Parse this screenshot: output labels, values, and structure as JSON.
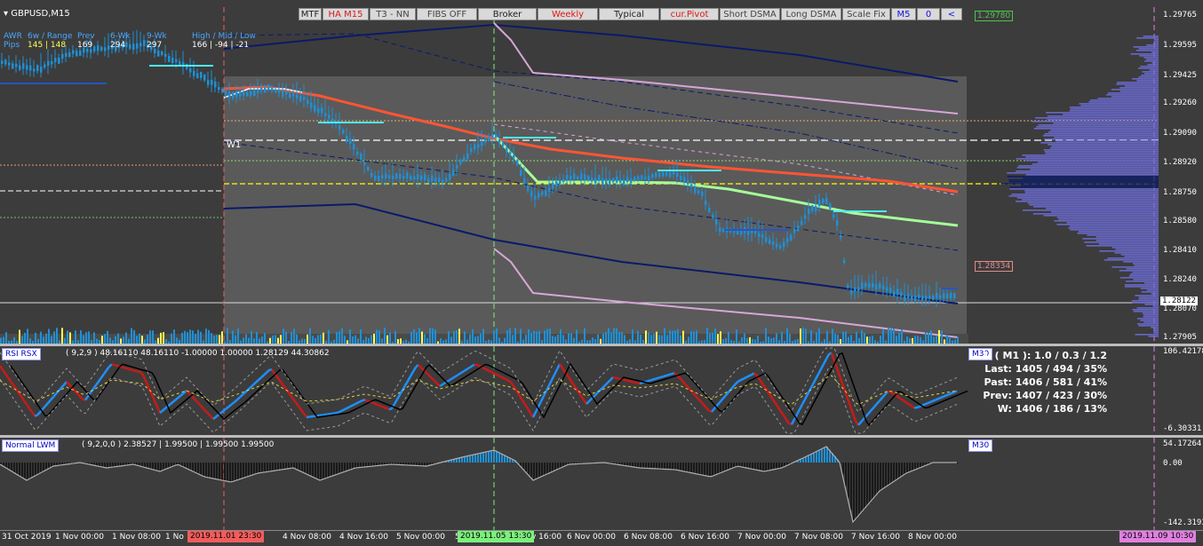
{
  "symbol": "GBPUSD,M15",
  "info": {
    "awr_label": "AWR",
    "pips_label": "Pips",
    "col1_head": "6w / Range",
    "col1_vals": "145 | 148",
    "col2_head": "Prev",
    "col2_val": "169",
    "col3_head": "6-Wk",
    "col3_val": "294",
    "col4_head": "9-Wk",
    "col4_val": "297",
    "col5_head": "High / Mid / Low",
    "col5_vals": "166 | -94 | -21"
  },
  "toolbar": [
    "MTF",
    "HA M15",
    "T3 - NN",
    "FIBS OFF",
    "Broker",
    "Weekly",
    "Typical",
    "cur.Pivot",
    "Short DSMA",
    "Long DSMA",
    "Scale Fix",
    "M5",
    "0",
    "<"
  ],
  "week_label": "W1",
  "price_labels": [
    "1.29765",
    "1.29595",
    "1.29425",
    "1.29260",
    "1.29090",
    "1.28920",
    "1.28750",
    "1.28580",
    "1.28410",
    "1.28240",
    "1.28070",
    "1.27905"
  ],
  "price_current": "1.28122",
  "price_tag_top": "1.29780",
  "price_tag_mid": "1.28334",
  "rsx": {
    "name": "RSI RSX",
    "params": "( 9,2,9 ) 48.16110 48.16110 -1.00000 1.00000 1.28129 44.30862",
    "tf": "M30",
    "axis_top": "106.42178",
    "axis_bottom": "-6.30331",
    "stats": [
      "V ( M1 ): 1.0 / 0.3 / 1.2",
      "Last: 1405 / 494 / 35%",
      "Past: 1406 / 581 / 41%",
      "Prev: 1407 / 423 / 30%",
      "W: 1406 / 186 / 13%"
    ]
  },
  "lwm": {
    "name": "Normal LWM",
    "params": "( 9,2,0,0 ) 2.38527 | 1.99500 | 1.99500 1.99500",
    "tf": "M30",
    "axis_top": "54.17264",
    "axis_zero": "0.00",
    "axis_bottom": "-142.3193"
  },
  "time_labels": [
    "31 Oct 2019",
    "1 Nov 00:00",
    "1 Nov 08:00",
    "1 No",
    "4 Nov 08:00",
    "4 Nov 16:00",
    "5 Nov 00:00",
    "5",
    "v 16:00",
    "6 Nov 00:00",
    "6 Nov 08:00",
    "6 Nov 16:00",
    "7 Nov 00:00",
    "7 Nov 08:00",
    "7 Nov 16:00",
    "8 Nov 00:00"
  ],
  "time_highlights": {
    "red": "2019.11.01 23:30",
    "green": "2019.11.05 13:30",
    "pink": "2019.11.09 10:30"
  },
  "colors": {
    "background": "#3c3c3c",
    "candle": "#1e90d6",
    "navy_band": "#0a1a6a",
    "pink_band": "#d8a6d8",
    "red_ma": "#ff5533",
    "green_ma": "#a6ff9a",
    "rsx_red": "#c81a1a",
    "rsx_blue": "#1e90ff",
    "rsx_green": "#3ad03a"
  }
}
